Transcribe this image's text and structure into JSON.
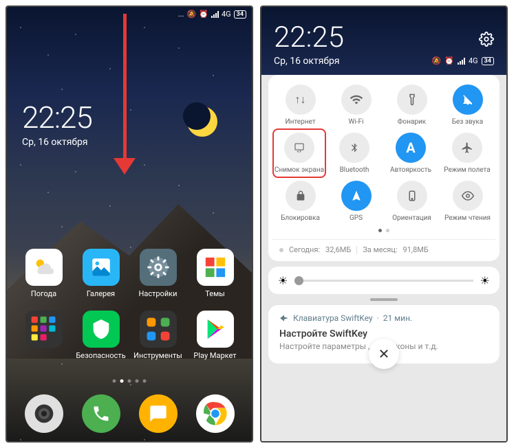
{
  "status": {
    "time": "22:25",
    "date": "Ср, 16 октября",
    "network": "4G",
    "battery": "34"
  },
  "home_apps_row1": [
    {
      "name": "weather",
      "label": "Погода",
      "bg": "#ffffff"
    },
    {
      "name": "gallery",
      "label": "Галерея",
      "bg": "#29b6f6"
    },
    {
      "name": "settings",
      "label": "Настройки",
      "bg": "#546e7a"
    },
    {
      "name": "themes",
      "label": "Темы",
      "bg": "#ffffff"
    }
  ],
  "home_apps_row2": [
    {
      "name": "folder",
      "label": "",
      "bg": "#333"
    },
    {
      "name": "security",
      "label": "Безопасность",
      "bg": "#00c853"
    },
    {
      "name": "tools",
      "label": "Инструменты",
      "bg": "#333"
    },
    {
      "name": "playstore",
      "label": "Play Маркет",
      "bg": "#ffffff"
    }
  ],
  "dock": [
    {
      "name": "camera",
      "bg": "#e0e0e0"
    },
    {
      "name": "phone",
      "bg": "#4caf50"
    },
    {
      "name": "messages",
      "bg": "#ffb300"
    },
    {
      "name": "chrome",
      "bg": "#ffffff"
    }
  ],
  "qs_tiles": [
    [
      {
        "name": "internet",
        "label": "Интернет",
        "icon": "data",
        "active": false
      },
      {
        "name": "wifi",
        "label": "Wi-Fi",
        "icon": "wifi",
        "active": false
      },
      {
        "name": "flashlight",
        "label": "Фонарик",
        "icon": "torch",
        "active": false
      },
      {
        "name": "silent",
        "label": "Без звука",
        "icon": "bell-off",
        "active": true
      }
    ],
    [
      {
        "name": "screenshot",
        "label": "Снимок экрана",
        "icon": "screenshot",
        "active": false,
        "highlighted": true
      },
      {
        "name": "bluetooth",
        "label": "Bluetooth",
        "icon": "bluetooth",
        "active": false
      },
      {
        "name": "autobright",
        "label": "Автояркость",
        "icon": "A",
        "active": true
      },
      {
        "name": "airplane",
        "label": "Режим полета",
        "icon": "plane",
        "active": false
      }
    ],
    [
      {
        "name": "lock",
        "label": "Блокировка",
        "icon": "lock",
        "active": false
      },
      {
        "name": "gps",
        "label": "GPS",
        "icon": "nav",
        "active": true
      },
      {
        "name": "orientation",
        "label": "Ориентация",
        "icon": "rotate",
        "active": false
      },
      {
        "name": "reading",
        "label": "Режим чтения",
        "icon": "eye",
        "active": false
      }
    ]
  ],
  "data_usage": {
    "today_label": "Сегодня:",
    "today_value": "32,6МБ",
    "month_label": "За месяц:",
    "month_value": "91,8МБ"
  },
  "notification": {
    "app_name": "Клавиатура SwiftKey",
    "time_ago": "21 мин.",
    "title": "Настройте SwiftKey",
    "body": "Настройте параметры               , эмотиконы и т.д."
  }
}
